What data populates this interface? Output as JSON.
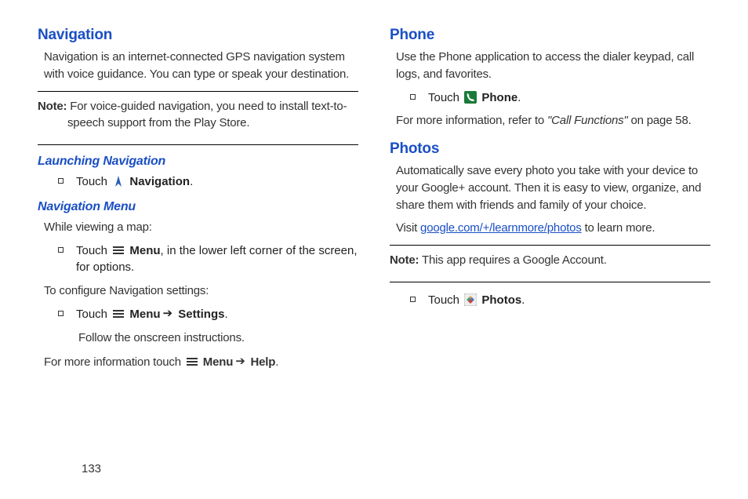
{
  "page_number": "133",
  "left": {
    "nav_heading": "Navigation",
    "nav_intro": "Navigation is an internet-connected GPS navigation system with voice guidance. You can type or speak your destination.",
    "note_label": "Note:",
    "note_text": " For voice-guided navigation, you need to install text-to-speech support from the Play Store.",
    "launch_heading": "Launching Navigation",
    "launch_touch": "Touch ",
    "launch_app": " Navigation",
    "period": ".",
    "menu_heading": "Navigation Menu",
    "while_viewing": "While viewing a map:",
    "menu_touch": "Touch ",
    "menu_label": " Menu",
    "menu_rest": ", in the lower left corner of the screen, for options.",
    "configure": "To configure Navigation settings:",
    "settings_touch": "Touch ",
    "settings_menu": " Menu",
    "settings_arrow": "➔",
    "settings_label": " Settings",
    "follow_instructions": "Follow the onscreen instructions.",
    "more_info_pre": "For more information touch ",
    "more_info_menu": " Menu",
    "more_info_arrow": "➔",
    "more_info_help": " Help"
  },
  "right": {
    "phone_heading": "Phone",
    "phone_intro": "Use the Phone application to access the dialer keypad, call logs, and favorites.",
    "phone_touch": "Touch ",
    "phone_label": " Phone",
    "period": ".",
    "phone_more_pre": "For more information, refer to ",
    "phone_ref": "\"Call Functions\"",
    "phone_more_post": " on page 58.",
    "photos_heading": "Photos",
    "photos_intro": "Automatically save every photo you take with your device to your Google+ account. Then it is easy to view, organize, and share them with friends and family of your choice.",
    "photos_visit_pre": "Visit ",
    "photos_link": "google.com/+/learnmore/photos",
    "photos_visit_post": " to learn more.",
    "note_label": "Note:",
    "note_text": " This app requires a Google Account.",
    "photos_touch": "Touch ",
    "photos_label": " Photos"
  }
}
